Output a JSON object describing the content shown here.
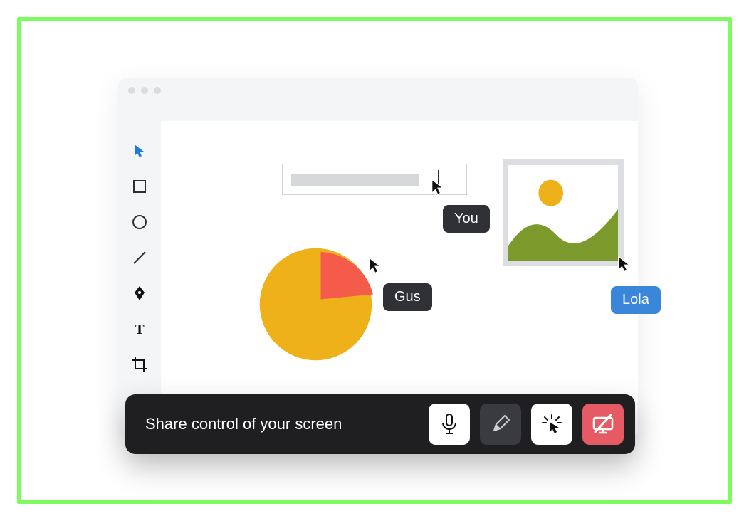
{
  "cursors": {
    "you": "You",
    "gus": "Gus",
    "lola": "Lola"
  },
  "toolbar": {
    "share_label": "Share control of your screen"
  },
  "tool_icons": {
    "pointer": "pointer-icon",
    "square": "square-icon",
    "circle": "circle-icon",
    "line": "line-icon",
    "pen": "pen-icon",
    "text": "text-icon",
    "crop": "crop-icon"
  },
  "share_buttons": {
    "mic": "microphone-icon",
    "pencil": "pencil-icon",
    "laser": "laser-pointer-icon",
    "stop": "stop-share-icon"
  },
  "colors": {
    "accent_blue": "#1f7ae0",
    "pie_main": "#eeb11a",
    "pie_slice": "#f55b4a",
    "image_hill": "#7c9a2b",
    "label_dark": "#2f3136",
    "label_blue": "#3a86d8",
    "stop_red": "#e65a63"
  }
}
